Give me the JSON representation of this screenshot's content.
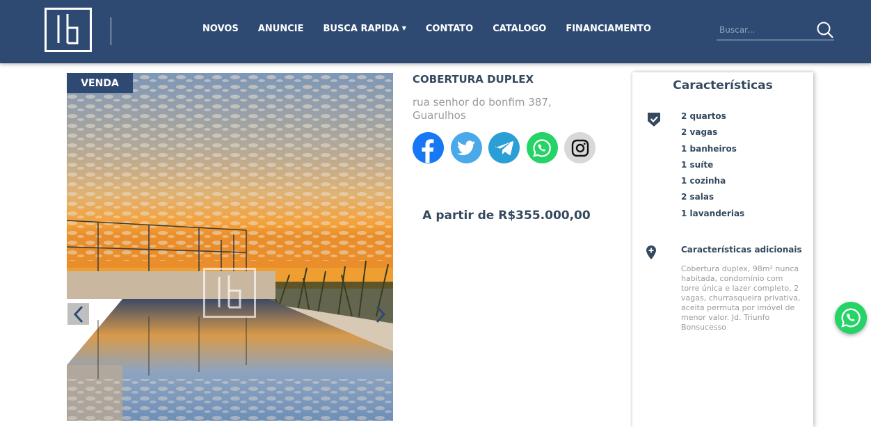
{
  "header": {
    "logo_alt": "ib",
    "nav": [
      {
        "label": "NOVOS",
        "has_dropdown": false
      },
      {
        "label": "ANUNCIE",
        "has_dropdown": false
      },
      {
        "label": "BUSCA RAPIDA",
        "has_dropdown": true
      },
      {
        "label": "CONTATO",
        "has_dropdown": false
      },
      {
        "label": "CATALOGO",
        "has_dropdown": false
      },
      {
        "label": "FINANCIAMENTO",
        "has_dropdown": false
      }
    ],
    "search": {
      "placeholder": "Buscar...",
      "value": "",
      "icon": "search-icon"
    }
  },
  "listing": {
    "badge": "VENDA",
    "title": "COBERTURA DUPLEX",
    "address": "rua senhor do bonfim 387, Guarulhos",
    "price": "A partir de R$355.000,00",
    "social": [
      {
        "name": "facebook",
        "icon": "facebook-icon",
        "color": "#1877f2"
      },
      {
        "name": "twitter",
        "icon": "twitter-icon",
        "color": "#4aa9e9"
      },
      {
        "name": "telegram",
        "icon": "telegram-icon",
        "color": "#2a9fd6"
      },
      {
        "name": "whatsapp",
        "icon": "whatsapp-icon",
        "color": "#25d366"
      },
      {
        "name": "instagram",
        "icon": "instagram-icon",
        "color": "#d8d8d8"
      }
    ]
  },
  "features_card": {
    "title": "Características",
    "features": [
      "2 quartos",
      "2 vagas",
      "1 banheiros",
      "1 suíte",
      "1 cozinha",
      "2 salas",
      "1 lavanderias"
    ],
    "extra_title": "Características adicionais",
    "extra_text": "Cobertura duplex, 98m² nunca habitada, condomínio com torre única e lazer completo, 2 vagas, churrasqueira privativa, aceita permuta por imóvel de menor valor. Jd. Triunfo Bonsucesso"
  },
  "colors": {
    "header_bg": "#2e4a72",
    "accent_text": "#34495e",
    "muted_text": "#9a9a9a",
    "whatsapp": "#25d366"
  }
}
